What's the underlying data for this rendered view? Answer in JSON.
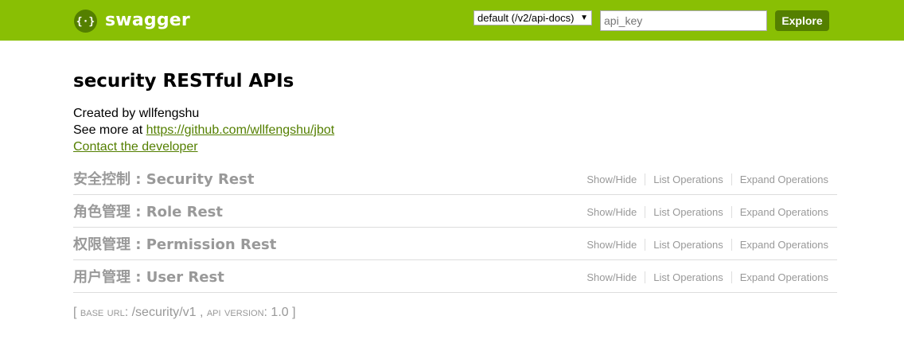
{
  "header": {
    "logo_text": "swagger",
    "spec_select": "default (/v2/api-docs)",
    "api_key_placeholder": "api_key",
    "explore_label": "Explore",
    "colors": {
      "bar": "#89bf04",
      "accent": "#547f00"
    }
  },
  "info": {
    "title": "security RESTful APIs",
    "created_by": "Created by wllfengshu",
    "see_more_prefix": "See more at ",
    "see_more_link": "https://github.com/wllfengshu/jbot",
    "contact": "Contact the developer"
  },
  "resources": [
    {
      "title": "安全控制 : Security Rest",
      "show_hide": "Show/Hide",
      "list_ops": "List Operations",
      "expand_ops": "Expand Operations"
    },
    {
      "title": "角色管理 : Role Rest",
      "show_hide": "Show/Hide",
      "list_ops": "List Operations",
      "expand_ops": "Expand Operations"
    },
    {
      "title": "权限管理 : Permission Rest",
      "show_hide": "Show/Hide",
      "list_ops": "List Operations",
      "expand_ops": "Expand Operations"
    },
    {
      "title": "用户管理 : User Rest",
      "show_hide": "Show/Hide",
      "list_ops": "List Operations",
      "expand_ops": "Expand Operations"
    }
  ],
  "footer": {
    "open": "[ ",
    "base_url_label": "base url",
    "base_url": ": /security/v1 , ",
    "api_version_label": "api version",
    "api_version": ": 1.0 ]"
  }
}
